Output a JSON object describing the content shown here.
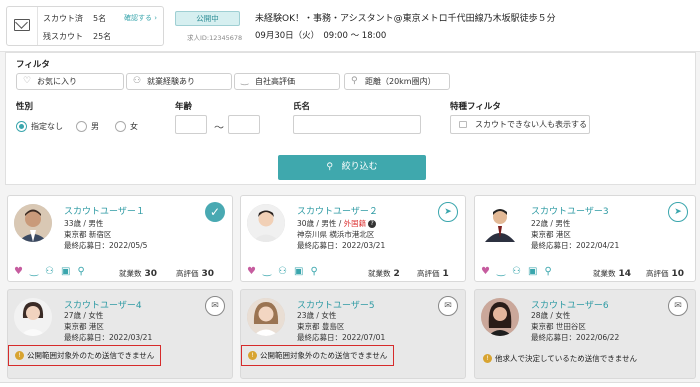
{
  "header": {
    "scout_sent_label": "スカウト済",
    "scout_sent_count": "5名",
    "scout_remaining_label": "残スカウト",
    "scout_remaining_count": "25名",
    "confirm_link": "確認する ›",
    "status_badge": "公開中",
    "job_id": "求人ID:12345678",
    "job_title": "未経験OK！・事務・アシスタント@東京メトロ千代田線乃木坂駅徒歩５分",
    "job_date": "09月30日（火）　09:00 〜 18:00"
  },
  "filter": {
    "title": "フィルタ",
    "buttons": [
      {
        "label": "お気に入り",
        "icon": "heart-icon"
      },
      {
        "label": "就業経験あり",
        "icon": "person-icon"
      },
      {
        "label": "自社高評価",
        "icon": "smile-icon"
      },
      {
        "label": "距離（20km圏内）",
        "icon": "pin-icon"
      }
    ],
    "gender_label": "性別",
    "gender_options": [
      "指定なし",
      "男",
      "女"
    ],
    "gender_selected": "指定なし",
    "age_label": "年齢",
    "age_separator": "〜",
    "age_from": "",
    "age_to": "",
    "name_label": "氏名",
    "name_value": "",
    "special_label": "特種フィルタ",
    "special_option": "スカウトできない人も表示する",
    "search_button": "絞り込む",
    "search_icon": "search-icon"
  },
  "cards": [
    {
      "name": "スカウトユーザー１",
      "age_gender": "33歳 / 男性",
      "foreign": "",
      "location": "東京都 新宿区",
      "last_applied": "最終応募日：2022/05/5",
      "action": "check",
      "work_count_label": "就業数",
      "work_count": "30",
      "rating_label": "高評価",
      "rating": "30",
      "notice": ""
    },
    {
      "name": "スカウトユーザー２",
      "age_gender": "30歳 / 男性 / ",
      "foreign": "外国籍",
      "location": "神奈川県 横浜市港北区",
      "last_applied": "最終応募日：2022/03/21",
      "action": "send",
      "work_count_label": "就業数",
      "work_count": "2",
      "rating_label": "高評価",
      "rating": "1",
      "notice": ""
    },
    {
      "name": "スカウトユーザー3",
      "age_gender": "22歳 / 男性",
      "foreign": "",
      "location": "東京都 港区",
      "last_applied": "最終応募日：2022/04/21",
      "action": "send",
      "work_count_label": "就業数",
      "work_count": "14",
      "rating_label": "高評価",
      "rating": "10",
      "notice": ""
    },
    {
      "name": "スカウトユーザー4",
      "age_gender": "27歳 / 女性",
      "foreign": "",
      "location": "東京都 港区",
      "last_applied": "最終応募日：2022/03/21",
      "action": "mail",
      "notice": "公開範囲対象外のため送信できません",
      "notice_boxed": true
    },
    {
      "name": "スカウトユーザー5",
      "age_gender": "23歳 / 女性",
      "foreign": "",
      "location": "東京都 豊島区",
      "last_applied": "最終応募日：2022/07/01",
      "action": "mail",
      "notice": "公開範囲対象外のため送信できません",
      "notice_boxed": true
    },
    {
      "name": "スカウトユーザー6",
      "age_gender": "28歳 / 女性",
      "foreign": "",
      "location": "東京都 世田谷区",
      "last_applied": "最終応募日：2022/06/22",
      "action": "mail",
      "notice": "他求人で決定しているため送信できません",
      "notice_boxed": false
    }
  ],
  "colors": {
    "accent": "#3fa8ad",
    "warning_border": "#d62b2b",
    "heart": "#c65c9f"
  }
}
